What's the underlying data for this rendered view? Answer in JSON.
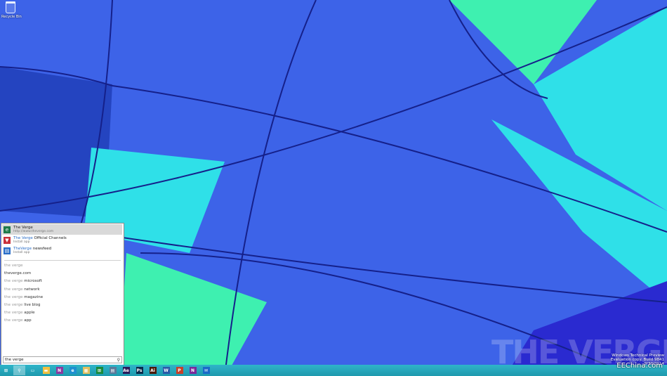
{
  "desktop": {
    "recycle_bin_label": "Recycle Bin",
    "colors": {
      "blue": "#3d63e8",
      "blue_dark": "#2444c0",
      "cyan": "#2fe0e8",
      "green": "#3ef0b0",
      "purple": "#2a2ad0",
      "seam": "#15208a"
    }
  },
  "search_panel": {
    "apps": [
      {
        "title": "The Verge",
        "title_highlight": "",
        "title_rest": "",
        "subtitle": "http://www.theverge.com",
        "icon": "internet-explorer-icon",
        "color": "#1e7a4a",
        "selected": true
      },
      {
        "title_highlight": "The Verge",
        "title_rest": " Official Channels",
        "subtitle": "Install app",
        "icon": "verge-app-icon",
        "color": "#c8303a",
        "selected": false
      },
      {
        "title_highlight": "TheVerge",
        "title_rest": " newsfeed",
        "subtitle": "Install app",
        "icon": "newsfeed-app-icon",
        "color": "#2a6ec8",
        "selected": false
      }
    ],
    "suggestions": [
      {
        "query": "the verge",
        "rest": ""
      },
      {
        "query": "",
        "rest": "theverge.com"
      },
      {
        "query": "the verge",
        "rest": " microsoft"
      },
      {
        "query": "the verge",
        "rest": " network"
      },
      {
        "query": "the verge",
        "rest": " magazine"
      },
      {
        "query": "the verge",
        "rest": " live blog"
      },
      {
        "query": "the verge",
        "rest": " apple"
      },
      {
        "query": "the verge",
        "rest": " app"
      }
    ],
    "search_value": "the verge",
    "search_icon": "magnifier-icon"
  },
  "taskbar": {
    "items": [
      {
        "name": "start-button",
        "glyph": "⊞",
        "color": "#ffffff",
        "active": false
      },
      {
        "name": "search-button",
        "glyph": "⚲",
        "color": "#ffffff",
        "active": true
      },
      {
        "name": "task-view-button",
        "glyph": "▭",
        "color": "#ffffff",
        "active": false
      },
      {
        "name": "file-explorer-button",
        "glyph": "▬",
        "color": "#f0c040",
        "active": false
      },
      {
        "name": "onenote-button",
        "glyph": "N",
        "color": "#8a3aa0",
        "active": false
      },
      {
        "name": "internet-explorer-button",
        "glyph": "e",
        "color": "#1e90d0",
        "active": false
      },
      {
        "name": "file-manager-button",
        "glyph": "▦",
        "color": "#e0c060",
        "active": false
      },
      {
        "name": "store-button",
        "glyph": "⊞",
        "color": "#1a8a3a",
        "active": false
      },
      {
        "name": "desktop-app-button",
        "glyph": "▤",
        "color": "#5a7a9a",
        "active": false
      },
      {
        "name": "after-effects-button",
        "glyph": "Ae",
        "color": "#2a1a5a",
        "active": false
      },
      {
        "name": "photoshop-button",
        "glyph": "Ps",
        "color": "#0a2a4a",
        "active": false
      },
      {
        "name": "illustrator-button",
        "glyph": "Ai",
        "color": "#4a1a0a",
        "active": false
      },
      {
        "name": "word-button",
        "glyph": "W",
        "color": "#2a5aa8",
        "active": false
      },
      {
        "name": "powerpoint-button",
        "glyph": "P",
        "color": "#c8402a",
        "active": false
      },
      {
        "name": "onenote-2-button",
        "glyph": "N",
        "color": "#7a2a9a",
        "active": false
      },
      {
        "name": "mail-button",
        "glyph": "✉",
        "color": "#1a6ac8",
        "active": false
      }
    ]
  },
  "watermark": {
    "text": "THE VERGE",
    "build_line1": "Windows Technical Preview",
    "build_line2": "Evaluation copy. Build 9841",
    "date": "9/30/2014"
  },
  "credit": "EEChina.com"
}
